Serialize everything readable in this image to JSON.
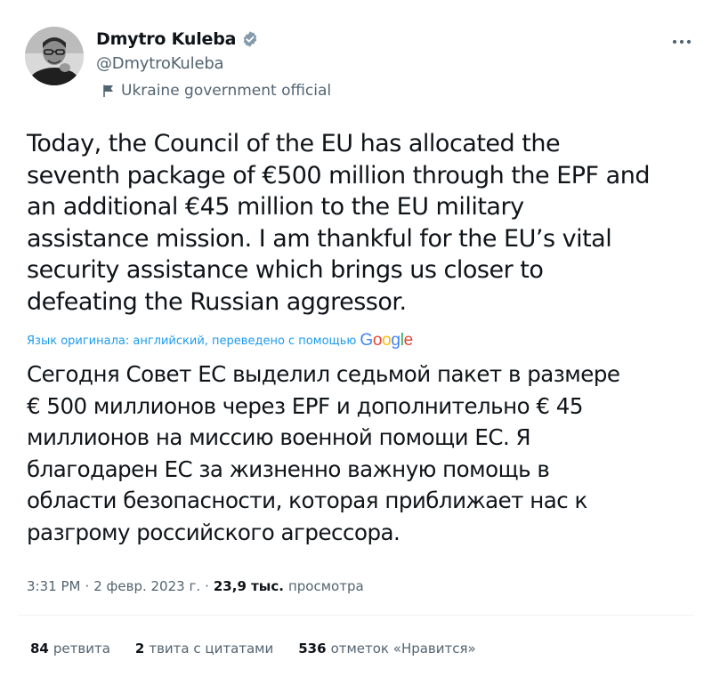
{
  "author": {
    "display_name": "Dmytro Kuleba",
    "handle": "@DmytroKuleba",
    "affiliation": "Ukraine government official"
  },
  "tweet": {
    "text": "Today, the Council of the EU has allocated the\nseventh package of €500 million through the EPF and\nan additional €45 million to the EU military\nassistance mission. I am thankful for the EU’s vital\nsecurity assistance which brings us closer to\ndefeating the Russian aggressor.",
    "translation_notice": "Язык оригинала: английский, переведено с помощью",
    "translation_provider": "Google",
    "translated_text": "Сегодня Совет ЕС выделил седьмой пакет в размере\n€ 500 миллионов через EPF и дополнительно € 45\nмиллионов на миссию военной помощи ЕС. Я\nблагодарен ЕС за жизненно важную помощь в\nобласти безопасности, которая приближает нас к\nразгрому российского агрессора.",
    "time": "3:31 PM",
    "date": "2 февр. 2023 г.",
    "views_count": "23,9 тыс.",
    "views_label": "просмотра",
    "separator": "·"
  },
  "stats": {
    "retweets_count": "84",
    "retweets_label": "ретвита",
    "quotes_count": "2",
    "quotes_label": "твита с цитатами",
    "likes_count": "536",
    "likes_label": "отметок «Нравится»"
  },
  "colors": {
    "text": "#0f1419",
    "secondary": "#536471",
    "link": "#1d9bf0",
    "verified_badge": "#829aab",
    "divider": "#eff3f4"
  },
  "icons": {
    "verified": "verified-badge-icon",
    "affiliation": "flag-icon",
    "more": "more-options-icon"
  }
}
